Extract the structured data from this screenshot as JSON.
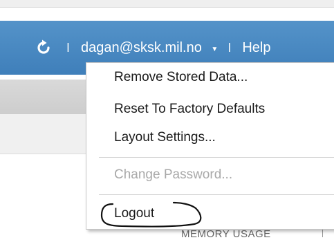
{
  "header": {
    "refresh_icon": "refresh-icon",
    "separator": "I",
    "user_email": "dagan@sksk.mil.no",
    "user_menu_icon": "caret-down-icon",
    "help_label": "Help",
    "background_color": "#4a89c2"
  },
  "user_menu": {
    "items": [
      {
        "label": "Remove Stored Data...",
        "enabled": true
      },
      {
        "label": "Reset To Factory Defaults",
        "enabled": true
      },
      {
        "label": "Layout Settings...",
        "enabled": true
      },
      {
        "label": "Change Password...",
        "enabled": false
      },
      {
        "label": "Logout",
        "enabled": true
      }
    ]
  },
  "footer": {
    "memory_usage_label": "MEMORY USAGE"
  }
}
